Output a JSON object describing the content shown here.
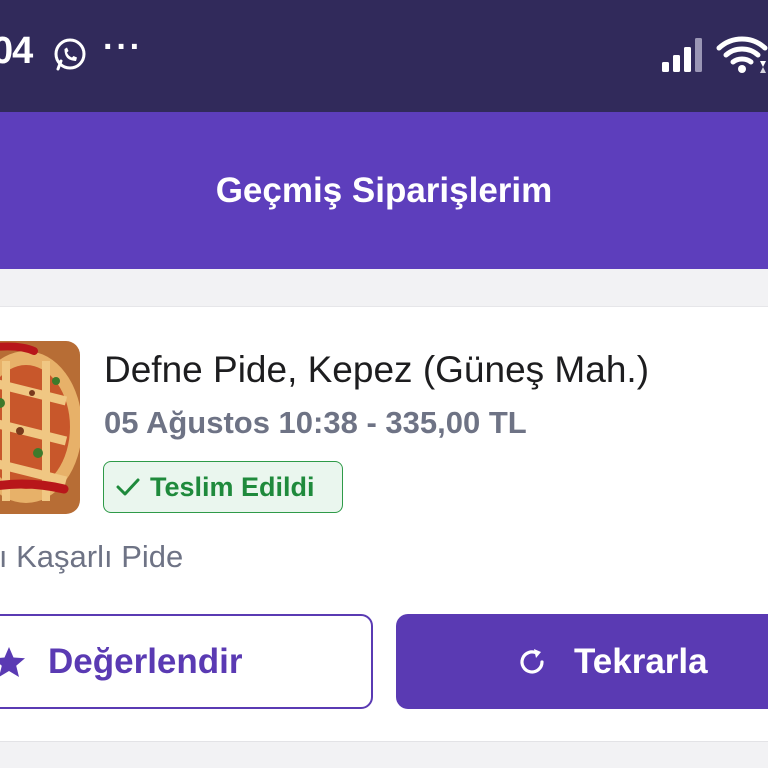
{
  "status_bar": {
    "time": "04",
    "more": "···",
    "icons": [
      "whatsapp-icon",
      "signal-icon",
      "wifi-icon"
    ]
  },
  "app_bar": {
    "title": "Geçmiş Siparişlerim",
    "background_color": "#5d3ebc"
  },
  "order": {
    "restaurant": "Defne Pide, Kepez (Güneş Mah.)",
    "meta": "05 Ağustos 10:38 - 335,00 TL",
    "status": "Teslim Edildi",
    "status_color": "#1f8a3c",
    "items": "lı Kaşarlı Pide",
    "actions": {
      "rate_label": "Değerlendir",
      "repeat_label": "Tekrarla"
    },
    "accent_color": "#5a3ab3"
  }
}
